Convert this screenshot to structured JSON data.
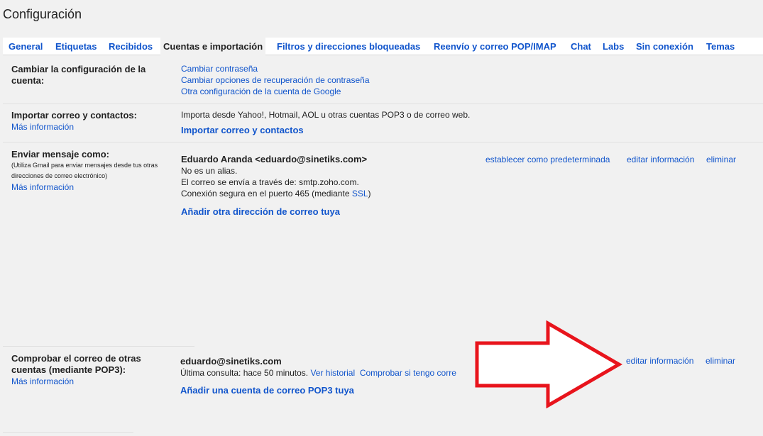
{
  "page_title": "Configuración",
  "tabs": [
    {
      "label": "General",
      "active": false
    },
    {
      "label": "Etiquetas",
      "active": false
    },
    {
      "label": "Recibidos",
      "active": false
    },
    {
      "label": "Cuentas e importación",
      "active": true
    },
    {
      "label": "Filtros y direcciones bloqueadas",
      "active": false
    },
    {
      "label": "Reenvío y correo POP/IMAP",
      "active": false
    },
    {
      "label": "Chat",
      "active": false
    },
    {
      "label": "Labs",
      "active": false
    },
    {
      "label": "Sin conexión",
      "active": false
    },
    {
      "label": "Temas",
      "active": false
    }
  ],
  "change_account": {
    "label": "Cambiar la configuración de la cuenta:",
    "links": [
      "Cambiar contraseña",
      "Cambiar opciones de recuperación de contraseña",
      "Otra configuración de la cuenta de Google"
    ]
  },
  "import": {
    "label": "Importar correo y contactos:",
    "more_info": "Más información",
    "description": "Importa desde Yahoo!, Hotmail, AOL u otras cuentas POP3 o de correo web.",
    "action": "Importar correo y contactos"
  },
  "send_as": {
    "label": "Enviar mensaje como:",
    "note": "(Utiliza Gmail para enviar mensajes desde tus otras direcciones de correo electrónico)",
    "more_info": "Más información",
    "identity": "Eduardo Aranda <eduardo@sinetiks.com>",
    "line1": "No es un alias.",
    "line2": "El correo se envía a través de: smtp.zoho.com.",
    "line3_prefix": "Conexión segura en el puerto 465 (mediante ",
    "line3_link": "SSL",
    "line3_suffix": ")",
    "set_default": "establecer como predeterminada",
    "edit": "editar información",
    "delete": "eliminar",
    "add_address": "Añadir otra dirección de correo tuya"
  },
  "check_mail": {
    "label": "Comprobar el correo de otras cuentas (mediante POP3):",
    "more_info": "Más información",
    "account": "eduardo@sinetiks.com",
    "last_check": "Última consulta: hace 50 minutos.",
    "history": "Ver historial",
    "check_now": "Comprobar si tengo corre",
    "edit": "editar información",
    "delete": "eliminar",
    "add_account": "Añadir una cuenta de correo POP3 tuya"
  },
  "colors": {
    "link": "#1155cc",
    "arrow": "#e8141c",
    "background": "#f1f1f1"
  }
}
